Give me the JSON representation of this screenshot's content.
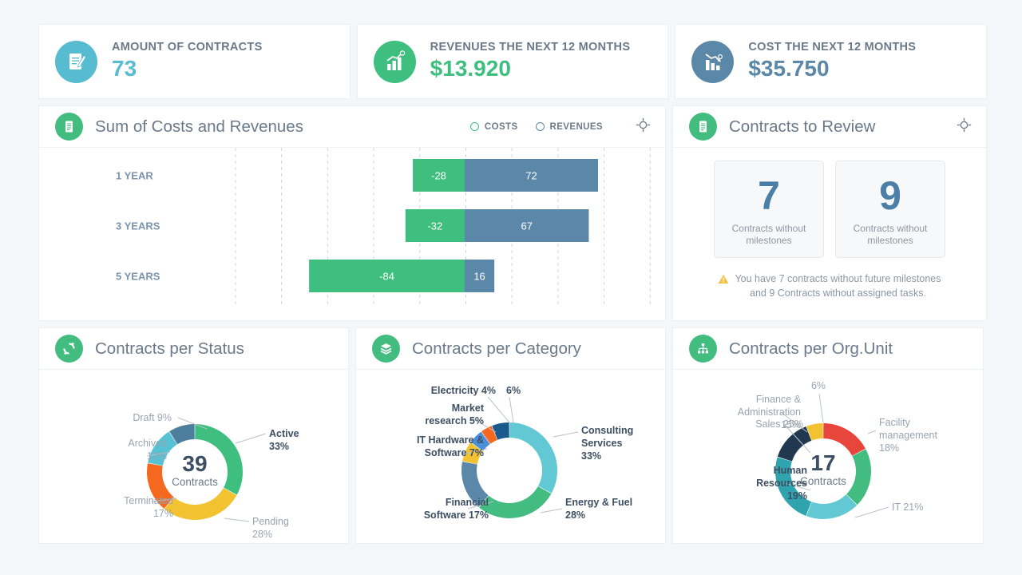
{
  "kpis": [
    {
      "icon": "contract-edit-icon",
      "title": "AMOUNT OF CONTRACTS",
      "value": "73",
      "icon_bg": "#58bcd0",
      "value_color": "#58bcd0"
    },
    {
      "icon": "revenue-chart-icon",
      "title": "REVENUES THE NEXT 12 MONTHS",
      "value": "$13.920",
      "icon_bg": "#3fbf7f",
      "value_color": "#3fbf7f"
    },
    {
      "icon": "cost-chart-icon",
      "title": "COST THE NEXT 12  MONTHS",
      "value": "$35.750",
      "icon_bg": "#5b87a8",
      "value_color": "#5b87a8"
    }
  ],
  "bar_panel": {
    "icon": "document-list-icon",
    "title": "Sum of Costs and Revenues",
    "legend": [
      {
        "label": "COSTS",
        "color": "#3fbf7f"
      },
      {
        "label": "REVENUES",
        "color": "#5b87a8"
      }
    ],
    "target_icon": "target-icon"
  },
  "review_panel": {
    "icon": "document-list-icon",
    "title": "Contracts to Review",
    "target_icon": "target-icon",
    "boxes": [
      {
        "value": "7",
        "caption": "Contracts without milestones"
      },
      {
        "value": "9",
        "caption": "Contracts without milestones"
      }
    ],
    "warning_icon": "warning-triangle-icon",
    "warning_line1": "You have 7 contracts without  future milestones",
    "warning_line2": "and 9 Contracts without  assigned tasks."
  },
  "status_panel": {
    "icon": "refresh-cycle-icon",
    "title": "Contracts per Status"
  },
  "category_panel": {
    "icon": "layers-icon",
    "title": "Contracts per Category"
  },
  "orgunit_panel": {
    "icon": "org-hierarchy-icon",
    "title": "Contracts per Org.Unit"
  },
  "chart_data": [
    {
      "type": "bar",
      "name": "sum-of-costs-and-revenues",
      "title": "Sum of Costs and Revenues",
      "orientation": "horizontal",
      "stacked": "diverging",
      "categories": [
        "1 YEAR",
        "3 YEARS",
        "5 YEARS"
      ],
      "series": [
        {
          "name": "COSTS",
          "color": "#3fbf7f",
          "values": [
            -28,
            -32,
            -84
          ],
          "labels": [
            "-28",
            "-32",
            "-84"
          ]
        },
        {
          "name": "REVENUES",
          "color": "#5b87a8",
          "values": [
            72,
            67,
            16
          ],
          "labels": [
            "72",
            "67",
            "16"
          ]
        }
      ],
      "xlabel": "",
      "ylabel": "",
      "grid": true,
      "legend_position": "top-right",
      "axis_zero_at_percent": 55.2
    },
    {
      "type": "pie",
      "name": "contracts-per-status",
      "title": "Contracts per Status",
      "center_value": "39",
      "center_label": "Contracts",
      "labels": [
        "Active",
        "Pending",
        "Terminated",
        "Archived",
        "Draft"
      ],
      "values": [
        33,
        28,
        17,
        13,
        9
      ],
      "value_suffix": "%",
      "colors": [
        "#3fbf7f",
        "#f2c230",
        "#f4681f",
        "#55c3d4",
        "#4e7e9e"
      ],
      "display": [
        {
          "label": "Active",
          "pct": "33%",
          "bold": true
        },
        {
          "label": "Pending",
          "pct": "28%",
          "bold": false
        },
        {
          "label": "Terminated",
          "pct": "17%",
          "bold": false
        },
        {
          "label": "Archived",
          "pct": "13%",
          "bold": false
        },
        {
          "label": "Draft 9%",
          "pct": "",
          "bold": false
        }
      ]
    },
    {
      "type": "pie",
      "name": "contracts-per-category",
      "title": "Contracts per Category",
      "labels": [
        "Consulting Services",
        "Energy & Fuel",
        "Financial Software",
        "IT Hardware & Software",
        "Market research",
        "Electricity",
        ""
      ],
      "values": [
        33,
        28,
        17,
        7,
        5,
        4,
        6
      ],
      "value_suffix": "%",
      "colors": [
        "#62c9d4",
        "#42bc81",
        "#5b87a8",
        "#f2c230",
        "#4a90d9",
        "#f4681f",
        "#1b5a8c"
      ],
      "display": [
        {
          "line1": "Consulting",
          "line2": "Services",
          "line3": "33%"
        },
        {
          "line1": "Energy & Fuel",
          "line2": "28%",
          "line3": ""
        },
        {
          "line1": "Financial",
          "line2": "Software 17%",
          "line3": ""
        },
        {
          "line1": "IT Hardware &",
          "line2": "Software 7%",
          "line3": ""
        },
        {
          "line1": "Market",
          "line2": "research 5%",
          "line3": ""
        },
        {
          "line1": "Electricity 4%",
          "line2": "",
          "line3": ""
        },
        {
          "line1": "6%",
          "line2": "",
          "line3": ""
        }
      ]
    },
    {
      "type": "pie",
      "name": "contracts-per-org-unit",
      "title": "Contracts per Org.Unit",
      "center_value": "17",
      "center_label": "Contracts",
      "labels": [
        "Facility management",
        "IT",
        "Human Resources",
        "Sales",
        "Finance & Administration",
        ""
      ],
      "values": [
        18,
        21,
        19,
        25,
        15,
        6
      ],
      "value_suffix": "%",
      "colors": [
        "#e8463c",
        "#42bc81",
        "#62c9d4",
        "#2fa3ae",
        "#22384f",
        "#f2c230"
      ],
      "display": [
        {
          "line1": "Facility",
          "line2": "management",
          "line3": "18%"
        },
        {
          "line1": "IT 21%",
          "line2": "",
          "line3": ""
        },
        {
          "line1": "Human",
          "line2": "Resources",
          "line3": "19%"
        },
        {
          "line1": "Sales 25%",
          "line2": "",
          "line3": ""
        },
        {
          "line1": "Finance &",
          "line2": "Administration",
          "line3": "15%"
        },
        {
          "line1": "6%",
          "line2": "",
          "line3": ""
        }
      ]
    }
  ]
}
